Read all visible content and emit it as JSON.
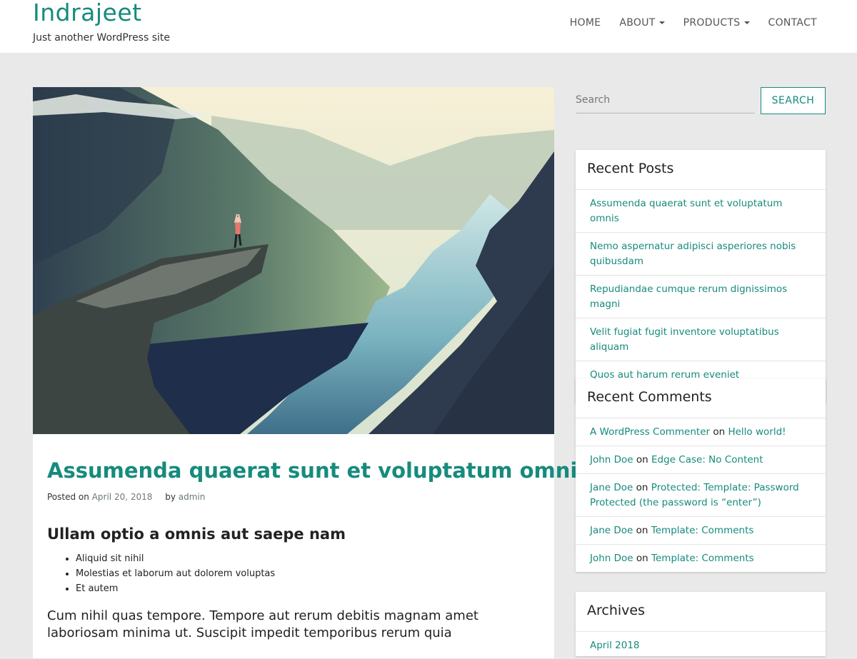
{
  "site": {
    "title": "Indrajeet",
    "description": "Just another WordPress site"
  },
  "nav": {
    "items": [
      {
        "label": "HOME",
        "dropdown": false
      },
      {
        "label": "ABOUT",
        "dropdown": true
      },
      {
        "label": "PRODUCTS",
        "dropdown": true
      },
      {
        "label": "CONTACT",
        "dropdown": false
      }
    ]
  },
  "article": {
    "title": "Assumenda quaerat sunt et voluptatum omnis",
    "meta": {
      "posted_on_label": "Posted on",
      "date": "April 20, 2018",
      "by_label": "by",
      "author": "admin"
    },
    "heading": "Ullam optio a omnis aut saepe nam",
    "bullets": [
      "Aliquid sit nihil",
      "Molestias et laborum aut dolorem voluptas",
      "Et autem"
    ],
    "paragraph": "Cum nihil quas tempore. Tempore aut rerum debitis magnam amet laboriosam minima ut. Suscipit impedit temporibus rerum quia"
  },
  "search": {
    "placeholder": "Search",
    "button_label": "SEARCH"
  },
  "recent_posts": {
    "title": "Recent Posts",
    "items": [
      "Assumenda quaerat sunt et voluptatum omnis",
      "Nemo aspernatur adipisci asperiores nobis quibusdam",
      "Repudiandae cumque rerum dignissimos magni",
      "Velit fugiat fugit inventore voluptatibus aliquam",
      "Quos aut harum rerum eveniet necessitatibus quasi"
    ]
  },
  "recent_comments": {
    "title": "Recent Comments",
    "on_label": "on",
    "items": [
      {
        "author": "A WordPress Commenter",
        "post": "Hello world!"
      },
      {
        "author": "John Doe",
        "post": "Edge Case: No Content"
      },
      {
        "author": "Jane Doe",
        "post": "Protected: Template: Password Protected (the password is “enter”)"
      },
      {
        "author": "Jane Doe",
        "post": "Template: Comments"
      },
      {
        "author": "John Doe",
        "post": "Template: Comments"
      }
    ]
  },
  "archives": {
    "title": "Archives",
    "items": [
      "April 2018"
    ]
  },
  "colors": {
    "accent": "#168b7d",
    "background": "#e9e9e9"
  }
}
